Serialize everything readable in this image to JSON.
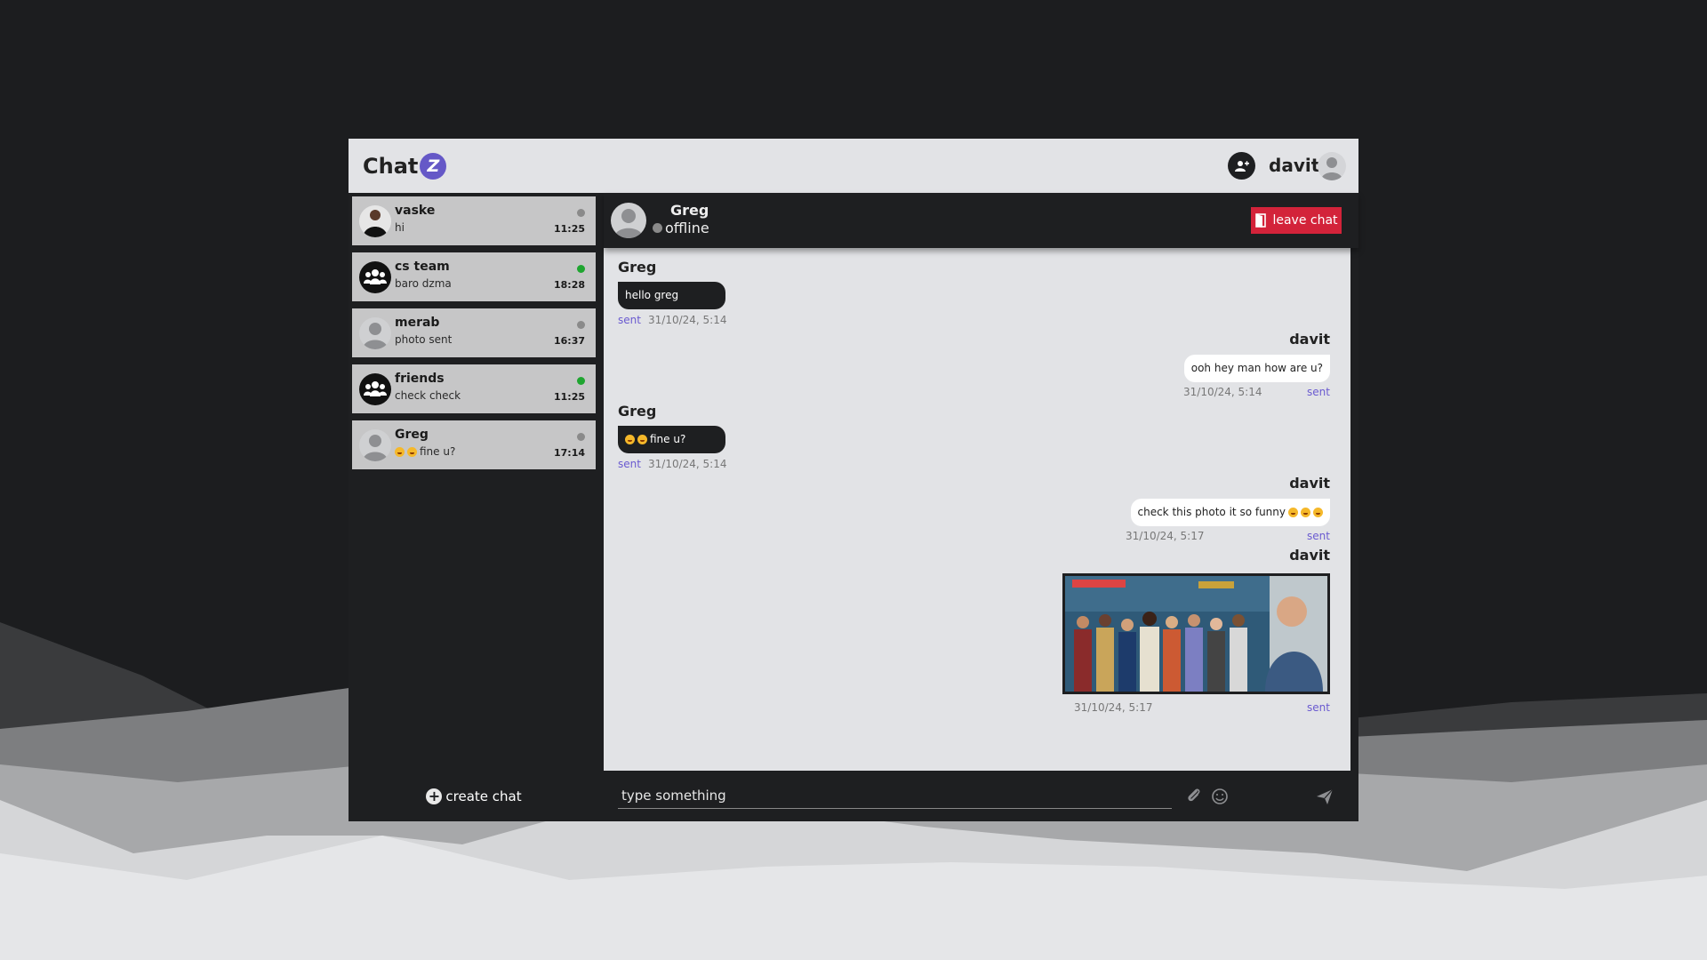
{
  "app": {
    "logo_text": "Chat",
    "logo_badge": "Z",
    "username": "davit"
  },
  "sidebar": {
    "chats": [
      {
        "name": "vaske",
        "preview": "hi",
        "time": "11:25",
        "online": false
      },
      {
        "name": "cs team",
        "preview": "baro dzma",
        "time": "18:28",
        "online": true
      },
      {
        "name": "merab",
        "preview": "photo sent",
        "time": "16:37",
        "online": false
      },
      {
        "name": "friends",
        "preview": "check check",
        "time": "11:25",
        "online": true
      },
      {
        "name": "Greg",
        "preview": "fine u?",
        "time": "17:14",
        "online": false
      }
    ],
    "create_chat_label": "create chat"
  },
  "chat": {
    "title": "Greg",
    "status": "offline",
    "leave_label": "leave chat",
    "messages": [
      {
        "author": "Greg",
        "text": "hello greg",
        "status": "sent",
        "time": "31/10/24, 5:14"
      },
      {
        "author": "davit",
        "text": "ooh hey man how are u?",
        "status": "sent",
        "time": "31/10/24, 5:14"
      },
      {
        "author": "Greg",
        "text": "fine u?",
        "status": "sent",
        "time": "31/10/24, 5:14"
      },
      {
        "author": "davit",
        "text": "check this photo it so funny",
        "status": "sent",
        "time": "31/10/24, 5:17"
      },
      {
        "author": "davit",
        "text": "",
        "status": "sent",
        "time": "31/10/24, 5:17"
      }
    ]
  },
  "composer": {
    "placeholder": "type something"
  },
  "colors": {
    "accent": "#6558c7",
    "danger": "#d3233a",
    "online": "#1fa530",
    "offline": "#8a8a8a"
  },
  "icons": [
    "add-user-icon",
    "user-icon",
    "group-icon",
    "door-icon",
    "paperclip-icon",
    "smiley-icon",
    "send-icon",
    "plus-icon"
  ]
}
